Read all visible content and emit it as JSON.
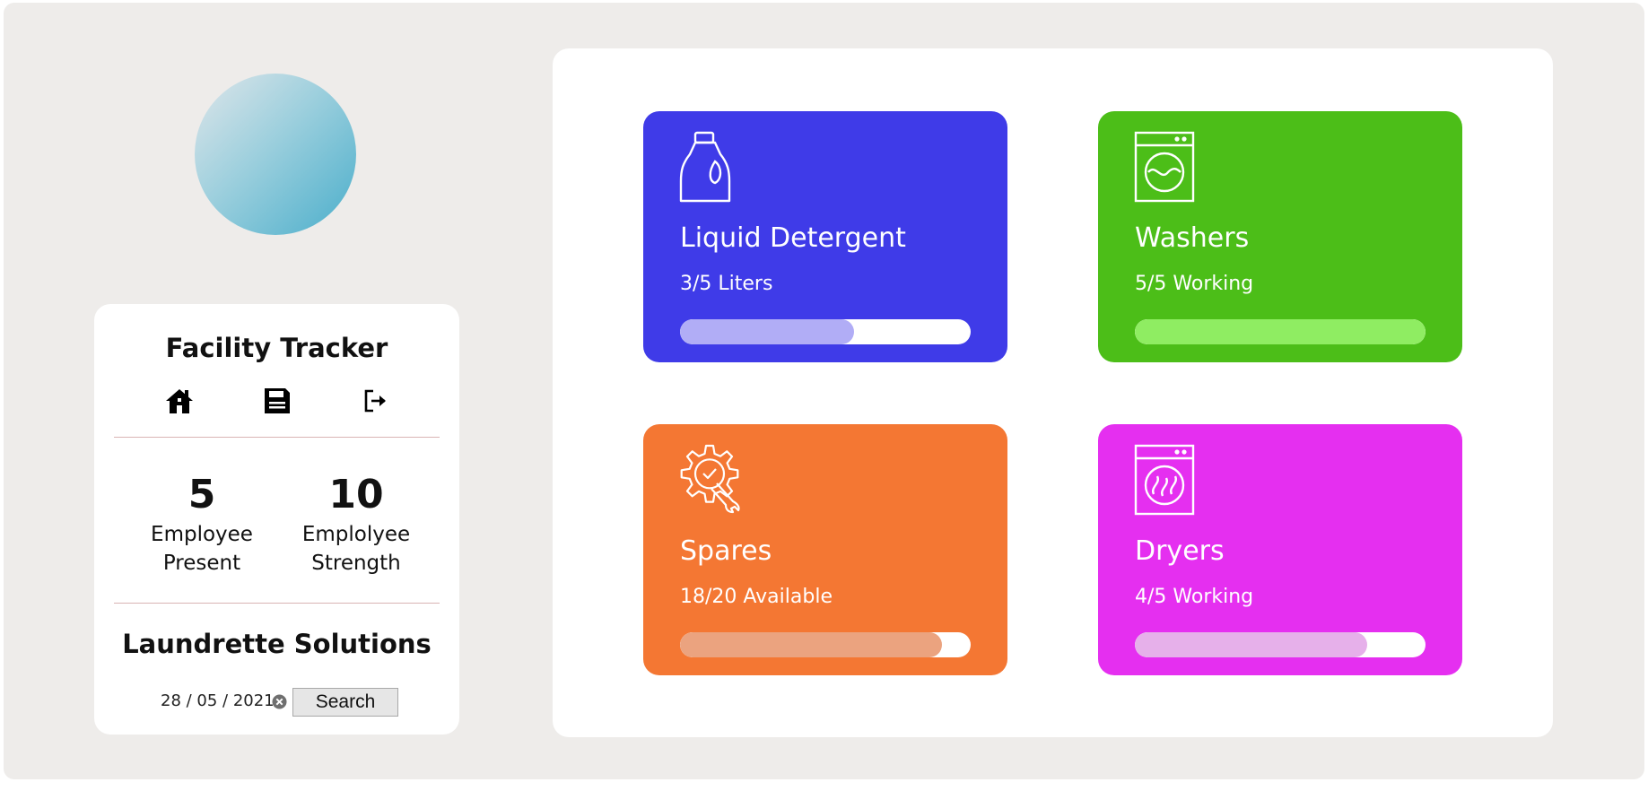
{
  "sidebar": {
    "title": "Facility Tracker",
    "nav": [
      {
        "name": "home",
        "icon": "home-icon"
      },
      {
        "name": "save",
        "icon": "save-icon"
      },
      {
        "name": "logout",
        "icon": "logout-icon"
      }
    ],
    "stats": [
      {
        "value": "5",
        "label": "Employee Present"
      },
      {
        "value": "10",
        "label": "Emplolyee Strength"
      }
    ],
    "company": "Laundrette Solutions",
    "date": "28 / 05 / 2021",
    "search_label": "Search"
  },
  "tiles": [
    {
      "title": "Liquid Detergent",
      "status": "3/5 Liters",
      "progress": 0.6,
      "color": "#3f3be8",
      "fill_color": "#b1adf6",
      "icon": "detergent-bottle-icon"
    },
    {
      "title": "Washers",
      "status": "5/5 Working",
      "progress": 1.0,
      "color": "#4cbe18",
      "fill_color": "#8fed62",
      "icon": "washing-machine-icon"
    },
    {
      "title": "Spares",
      "status": "18/20 Available",
      "progress": 0.9,
      "color": "#f47733",
      "fill_color": "#eba37f",
      "icon": "gear-wrench-icon"
    },
    {
      "title": "Dryers",
      "status": "4/5 Working",
      "progress": 0.8,
      "color": "#e52ff0",
      "fill_color": "#e6b0ea",
      "icon": "dryer-icon"
    }
  ]
}
